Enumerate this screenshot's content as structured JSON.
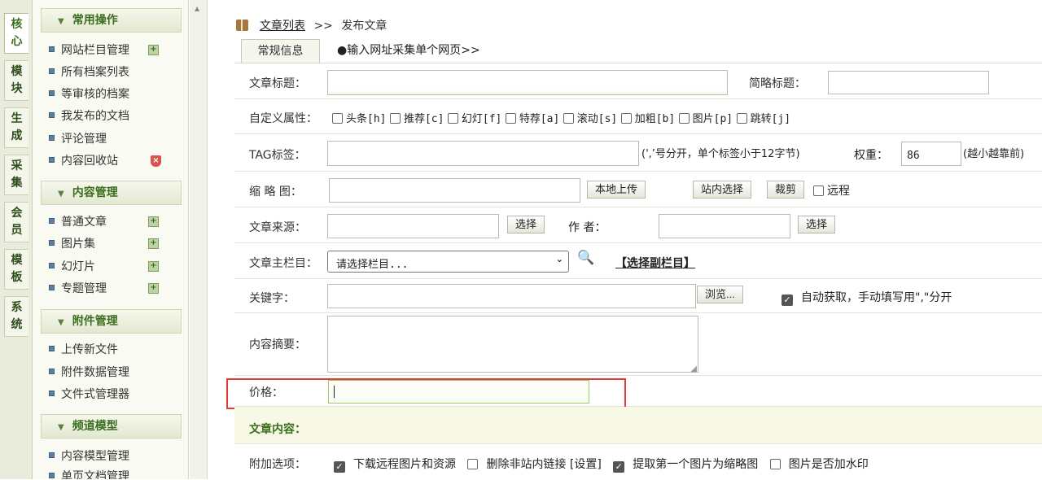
{
  "vtabs": [
    [
      "核",
      "心"
    ],
    [
      "模",
      "块"
    ],
    [
      "生",
      "成"
    ],
    [
      "采",
      "集"
    ],
    [
      "会",
      "员"
    ],
    [
      "模",
      "板"
    ],
    [
      "系",
      "统"
    ]
  ],
  "menu": {
    "groups": [
      {
        "title": "常用操作",
        "items": [
          "网站栏目管理",
          "所有档案列表",
          "等审核的档案",
          "我发布的文档",
          "评论管理",
          "内容回收站"
        ]
      },
      {
        "title": "内容管理",
        "items": [
          "普通文章",
          "图片集",
          "幻灯片",
          "专题管理"
        ]
      },
      {
        "title": "附件管理",
        "items": [
          "上传新文件",
          "附件数据管理",
          "文件式管理器"
        ]
      },
      {
        "title": "频道模型",
        "items": [
          "内容模型管理",
          "单页文档管理"
        ]
      }
    ]
  },
  "breadcrumb": {
    "link": "文章列表",
    "sep": ">>",
    "current": "发布文章"
  },
  "tabs": {
    "general": "常规信息",
    "collect": "●输入网址采集单个网页>>"
  },
  "form": {
    "title_label": "文章标题：",
    "short_title_label": "简略标题：",
    "attr_label": "自定义属性：",
    "attrs": [
      "头条[h]",
      "推荐[c]",
      "幻灯[f]",
      "特荐[a]",
      "滚动[s]",
      "加粗[b]",
      "图片[p]",
      "跳转[j]"
    ],
    "tag_label": "TAG标签：",
    "tag_hint": "(',’号分开，单个标签小于12字节)",
    "weight_label": "权重：",
    "weight_value": "86",
    "weight_hint": "(越小越靠前)",
    "thumb_label": "缩 略 图：",
    "local_upload": "本地上传",
    "site_select": "站内选择",
    "crop": "裁剪",
    "remote": "远程",
    "source_label": "文章来源：",
    "select_btn": "选择",
    "author_label": "作 者：",
    "column_label": "文章主栏目：",
    "column_select": "请选择栏目...",
    "sub_column": "【选择副栏目】",
    "keywords_label": "关键字：",
    "browse": "浏览...",
    "auto_fetch": "自动获取，手动填写用\",\"分开",
    "summary_label": "内容摘要：",
    "price_label": "价格：",
    "price_value": "",
    "content_section": "文章内容：",
    "extra_label": "附加选项：",
    "extras": [
      "下载远程图片和资源",
      "删除非站内链接 [设置]",
      "提取第一个图片为缩略图",
      "图片是否加水印"
    ],
    "extras_checked": [
      true,
      false,
      true,
      false
    ]
  },
  "colors": {
    "accent_green": "#3b6e1e",
    "highlight_red": "#e53935",
    "section_bg": "#f7f8e6"
  }
}
